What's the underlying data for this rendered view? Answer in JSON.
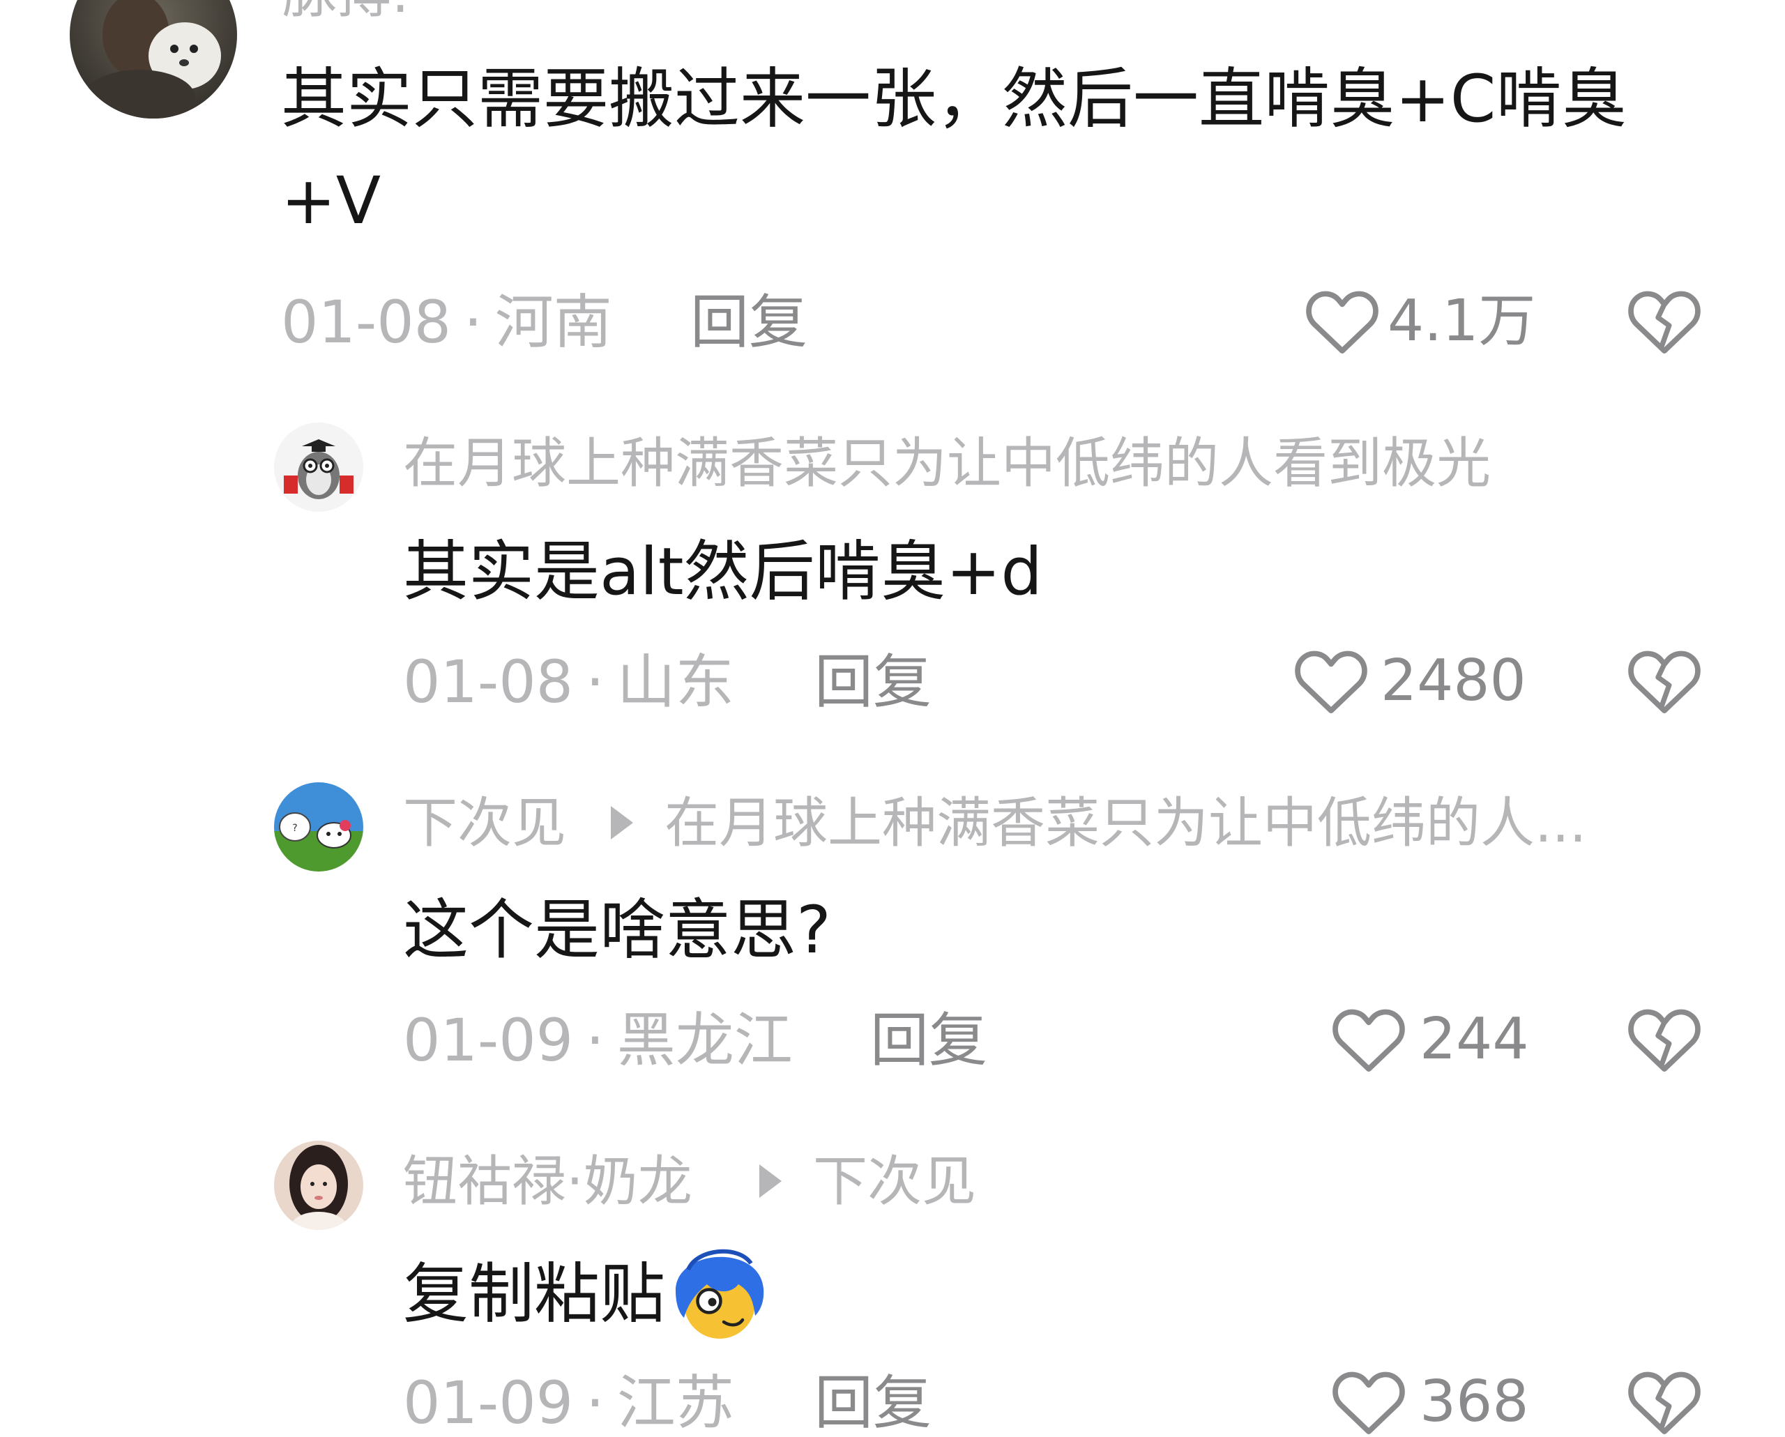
{
  "colors": {
    "text_primary": "#161616",
    "text_secondary": "#b6b6b8",
    "text_action": "#8a8a8c",
    "background": "#ffffff"
  },
  "comments": [
    {
      "username": "脉搏:",
      "text": "其实只需要搬过来一张，然后一直啃臭+C啃臭+V",
      "date": "01-08",
      "location": "河南",
      "reply_label": "回复",
      "likes": "4.1万"
    },
    {
      "username": "在月球上种满香菜只为让中低纬的人看到极光",
      "text": "其实是alt然后啃臭+d",
      "date": "01-08",
      "location": "山东",
      "reply_label": "回复",
      "likes": "2480"
    },
    {
      "username": "下次见",
      "reply_to": "在月球上种满香菜只为让中低纬的人...",
      "text": "这个是啥意思?",
      "date": "01-09",
      "location": "黑龙江",
      "reply_label": "回复",
      "likes": "244"
    },
    {
      "username": "钮祜禄·奶龙",
      "reply_to": "下次见",
      "text": "复制粘贴",
      "date": "01-09",
      "location": "江苏",
      "reply_label": "回复",
      "likes": "368"
    }
  ],
  "separator": "·",
  "icons": {
    "like": "heart-outline-icon",
    "dislike": "broken-heart-icon",
    "reply_arrow": "play-triangle-icon",
    "emoji": "blue-hair-face-emoji"
  }
}
